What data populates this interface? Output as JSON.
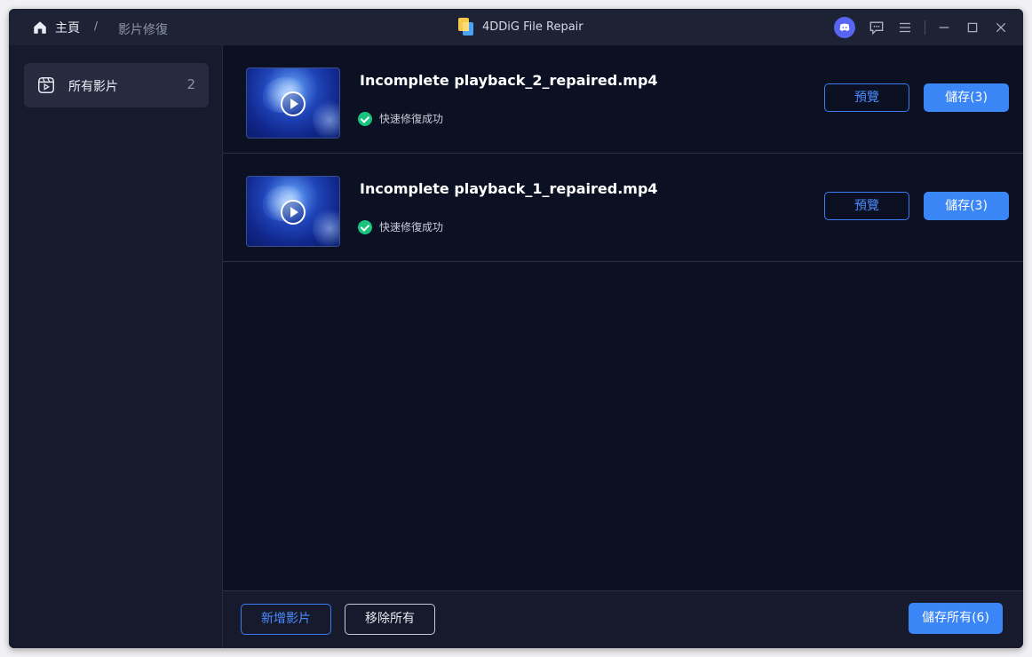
{
  "titlebar": {
    "home_label": "主頁",
    "separator": "/",
    "current_page": "影片修復",
    "app_name": "4DDiG File Repair"
  },
  "sidebar": {
    "items": [
      {
        "label": "所有影片",
        "count": "2",
        "icon": "video-library-icon"
      }
    ]
  },
  "files": [
    {
      "name": "Incomplete playback_2_repaired.mp4",
      "status": "快速修復成功",
      "preview_label": "預覽",
      "save_label": "儲存(3)"
    },
    {
      "name": "Incomplete playback_1_repaired.mp4",
      "status": "快速修復成功",
      "preview_label": "預覽",
      "save_label": "儲存(3)"
    }
  ],
  "footer": {
    "add_label": "新增影片",
    "remove_label": "移除所有",
    "save_all_label": "儲存所有(6)"
  },
  "colors": {
    "accent": "#3a86f7",
    "success": "#19c37d",
    "background": "#0b1022",
    "sidebar": "#161a2c"
  }
}
